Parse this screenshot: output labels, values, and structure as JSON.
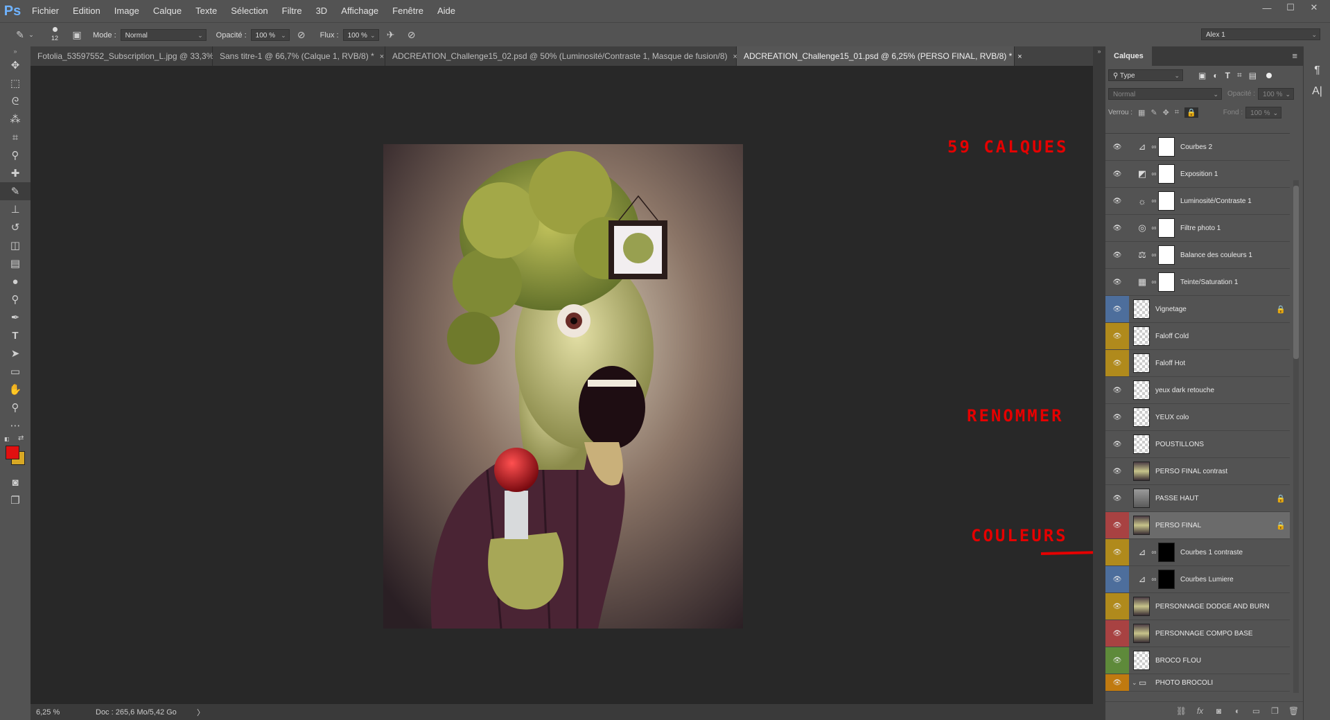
{
  "app": {
    "logo": "Ps"
  },
  "menu": [
    "Fichier",
    "Edition",
    "Image",
    "Calque",
    "Texte",
    "Sélection",
    "Filtre",
    "3D",
    "Affichage",
    "Fenêtre",
    "Aide"
  ],
  "window_controls": [
    "—",
    "☐",
    "✕"
  ],
  "options": {
    "brush_size": "12",
    "mode_label": "Mode :",
    "mode_value": "Normal",
    "opacity_label": "Opacité :",
    "opacity_value": "100 %",
    "flow_label": "Flux :",
    "flow_value": "100 %",
    "user": "Alex 1"
  },
  "tabs": [
    {
      "label": "Fotolia_53597552_Subscription_L.jpg @ 33,3% (RVB/8) *",
      "close": "×"
    },
    {
      "label": "Sans titre-1 @ 66,7% (Calque 1, RVB/8) *",
      "close": "×"
    },
    {
      "label": "ADCREATION_Challenge15_02.psd @ 50% (Luminosité/Contraste 1, Masque de fusion/8)",
      "close": "×"
    },
    {
      "label": "ADCREATION_Challenge15_01.psd @ 6,25% (PERSO FINAL, RVB/8) *",
      "close": "×"
    }
  ],
  "status": {
    "zoom": "6,25 %",
    "doc": "Doc : 265,6 Mo/5,42 Go",
    "arrow": "〉"
  },
  "layers_panel": {
    "title": "Calques",
    "filter": "Type",
    "blend": "Normal",
    "opacity_label": "Opacité :",
    "opacity_value": "100 %",
    "lock_label": "Verrou :",
    "fill_label": "Fond :",
    "fill_value": "100 %",
    "layers": [
      {
        "name": "Courbes 2",
        "type": "adj",
        "icon": "⊿",
        "thumb": "white",
        "color": "#535353"
      },
      {
        "name": "Exposition 1",
        "type": "adj",
        "icon": "◩",
        "thumb": "white",
        "color": "#535353"
      },
      {
        "name": "Luminosité/Contraste 1",
        "type": "adj",
        "icon": "☼",
        "thumb": "white",
        "color": "#535353"
      },
      {
        "name": "Filtre photo 1",
        "type": "adj",
        "icon": "◎",
        "thumb": "white",
        "color": "#535353"
      },
      {
        "name": "Balance des couleurs 1",
        "type": "adj",
        "icon": "⚖",
        "thumb": "white",
        "color": "#535353"
      },
      {
        "name": "Teinte/Saturation 1",
        "type": "adj",
        "icon": "▦",
        "thumb": "white",
        "color": "#535353"
      },
      {
        "name": "Vignetage",
        "type": "pixel",
        "thumb": "trans",
        "color": "#4d6e9c",
        "lock": true
      },
      {
        "name": "Faloff Cold",
        "type": "pixel",
        "thumb": "trans",
        "color": "#b08a1c"
      },
      {
        "name": "Faloff Hot",
        "type": "pixel",
        "thumb": "trans",
        "color": "#b08a1c"
      },
      {
        "name": "yeux dark retouche",
        "type": "pixel",
        "thumb": "trans",
        "color": "#535353"
      },
      {
        "name": "YEUX colo",
        "type": "pixel",
        "thumb": "trans",
        "color": "#535353"
      },
      {
        "name": "POUSTILLONS",
        "type": "pixel",
        "thumb": "trans",
        "color": "#535353"
      },
      {
        "name": "PERSO FINAL contrast",
        "type": "pixel",
        "thumb": "photo",
        "color": "#535353"
      },
      {
        "name": "PASSE HAUT",
        "type": "pixel",
        "thumb": "gray",
        "color": "#535353",
        "lock": true
      },
      {
        "name": "PERSO FINAL",
        "type": "pixel",
        "thumb": "photo",
        "color": "#a84242",
        "lock": true,
        "selected": true
      },
      {
        "name": "Courbes 1 contraste",
        "type": "adj",
        "icon": "⊿",
        "thumb": "black",
        "color": "#b08a1c"
      },
      {
        "name": "Courbes Lumiere",
        "type": "adj",
        "icon": "⊿",
        "thumb": "black",
        "color": "#4d6e9c"
      },
      {
        "name": "PERSONNAGE DODGE AND BURN",
        "type": "pixel",
        "thumb": "photo",
        "color": "#b08a1c"
      },
      {
        "name": "PERSONNAGE COMPO BASE",
        "type": "pixel",
        "thumb": "photo",
        "color": "#a84242"
      },
      {
        "name": "BROCO FLOU",
        "type": "pixel",
        "thumb": "trans",
        "color": "#5e8a3a"
      },
      {
        "name": "PHOTO BROCOLI",
        "type": "group",
        "color": "#c07a10"
      }
    ]
  },
  "annotations": {
    "count": "59 CALQUES",
    "rename": "RENOMMER",
    "colors": "COULEURS"
  },
  "colors": {
    "accent_red": "#e50000",
    "fg_swatch": "#e01010",
    "bg_swatch": "#d8a824"
  }
}
